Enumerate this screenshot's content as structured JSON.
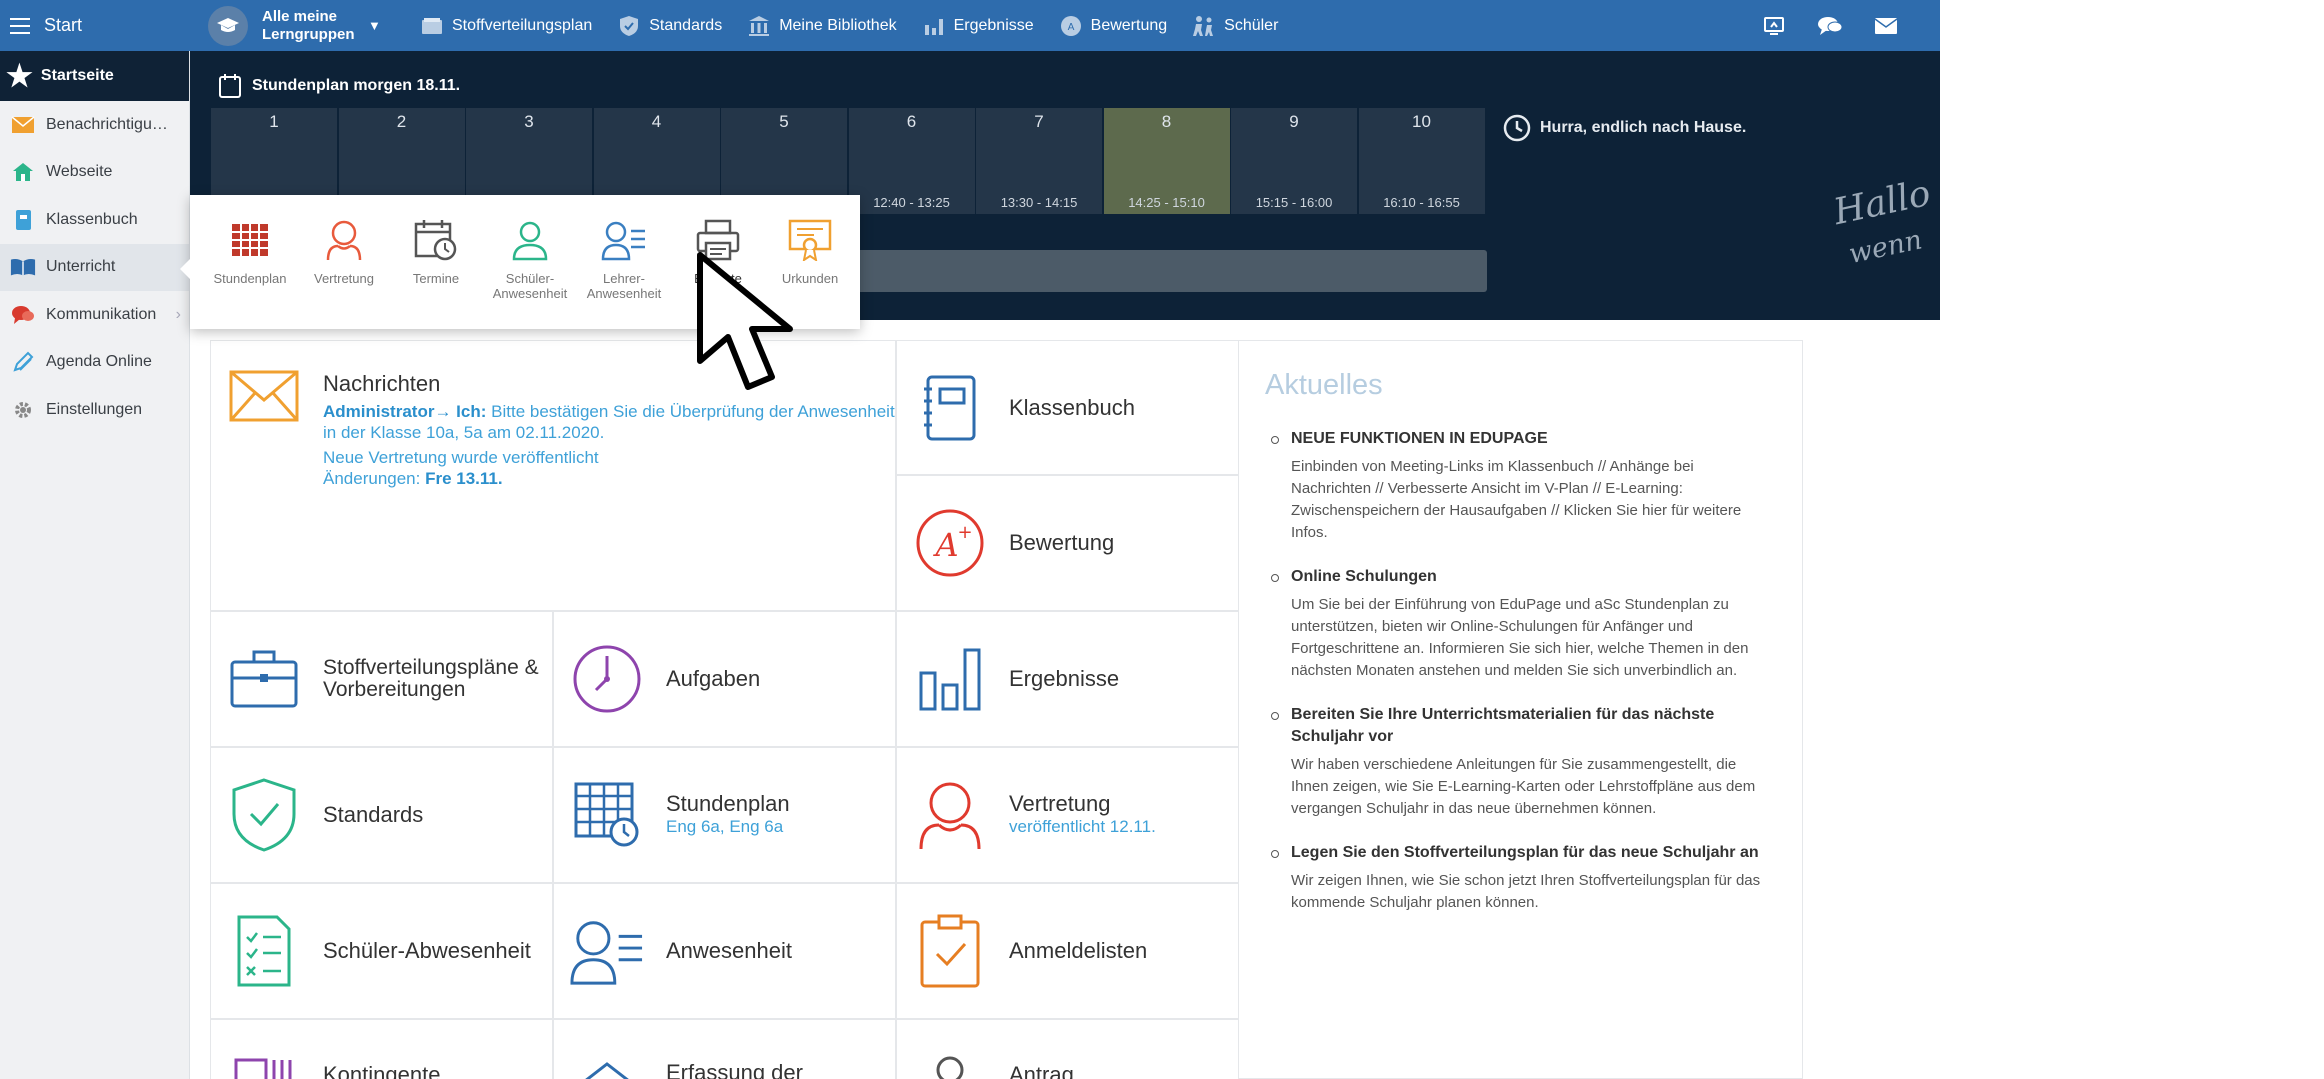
{
  "topbar": {
    "start_label": "Start",
    "groups_label": "Alle meine Lerngruppen",
    "nav": [
      {
        "label": "Stoffverteilungsplan",
        "icon": "books-icon"
      },
      {
        "label": "Standards",
        "icon": "shield-icon"
      },
      {
        "label": "Meine Bibliothek",
        "icon": "library-icon"
      },
      {
        "label": "Ergebnisse",
        "icon": "bar-chart-icon"
      },
      {
        "label": "Bewertung",
        "icon": "grade-icon"
      },
      {
        "label": "Schüler",
        "icon": "students-icon"
      }
    ]
  },
  "sidebar": {
    "home_label": "Startseite",
    "items": [
      {
        "label": "Benachrichtigu…",
        "icon": "envelope-icon",
        "color": "#f0a030"
      },
      {
        "label": "Webseite",
        "icon": "house-icon",
        "color": "#2bb58a"
      },
      {
        "label": "Klassenbuch",
        "icon": "notebook-icon",
        "color": "#3ea1d8"
      },
      {
        "label": "Unterricht",
        "icon": "open-book-icon",
        "color": "#2e6cad"
      },
      {
        "label": "Kommunikation",
        "icon": "chat-icon",
        "color": "#d83a2e"
      },
      {
        "label": "Agenda Online",
        "icon": "pen-icon",
        "color": "#3ea1d8"
      },
      {
        "label": "Einstellungen",
        "icon": "gear-icon",
        "color": "#888888"
      }
    ]
  },
  "hero": {
    "title": "Stundenplan morgen 18.11.",
    "periods": [
      {
        "num": "1",
        "time": ""
      },
      {
        "num": "2",
        "time": ""
      },
      {
        "num": "3",
        "time": ""
      },
      {
        "num": "4",
        "time": ""
      },
      {
        "num": "5",
        "time": ""
      },
      {
        "num": "6",
        "time": "12:40 - 13:25"
      },
      {
        "num": "7",
        "time": "13:30 - 14:15"
      },
      {
        "num": "8",
        "time": "14:25 - 15:10"
      },
      {
        "num": "9",
        "time": "15:15 - 16:00"
      },
      {
        "num": "10",
        "time": "16:10 - 16:55"
      }
    ],
    "note": "Hurra, endlich nach Hause.",
    "handwriting_1": "Hallo",
    "handwriting_2": "wenn"
  },
  "popup": {
    "items": [
      {
        "label": "Stundenplan",
        "icon": "timetable-icon"
      },
      {
        "label": "Vertretung",
        "icon": "substitute-icon"
      },
      {
        "label": "Termine",
        "icon": "calendar-clock-icon"
      },
      {
        "label": "Schüler-Anwesenheit",
        "icon": "student-attendance-icon"
      },
      {
        "label": "Lehrer-Anwesenheit",
        "icon": "teacher-attendance-icon"
      },
      {
        "label": "Berichte",
        "icon": "printer-icon"
      },
      {
        "label": "Urkunden",
        "icon": "certificate-icon"
      }
    ]
  },
  "tiles": {
    "messages": {
      "title": "Nachrichten",
      "line1_bold": "Administrator→ Ich:",
      "line1_rest": " Bitte bestätigen Sie die Überprüfung der Anwesenheit in der Klasse 10a, 5a am 02.11.2020.",
      "line2": "Neue Vertretung wurde veröffentlicht",
      "line3_prefix": "Änderungen: ",
      "line3_bold": "Fre 13.11."
    },
    "klassenbuch": "Klassenbuch",
    "bewertung": "Bewertung",
    "stoffverteilung": "Stoffverteilungspläne & Vorbereitungen",
    "aufgaben": "Aufgaben",
    "ergebnisse": "Ergebnisse",
    "standards": "Standards",
    "stundenplan": "Stundenplan",
    "stundenplan_sub": "Eng 6a, Eng 6a",
    "vertretung": "Vertretung",
    "vertretung_sub": "veröffentlicht 12.11.",
    "schueler_abw": "Schüler-Abwesenheit",
    "anwesenheit": "Anwesenheit",
    "anmeldelisten": "Anmeldelisten",
    "bottom_1": "Kontingente",
    "bottom_2": "Erfassung der",
    "bottom_3": "Antrag"
  },
  "news": {
    "title": "Aktuelles",
    "items": [
      {
        "heading": "NEUE FUNKTIONEN IN EDUPAGE",
        "body": "Einbinden von Meeting-Links im Klassenbuch // Anhänge bei Nachrichten // Verbesserte Ansicht im V-Plan // E-Learning: Zwischenspeichern der Hausaufgaben // Klicken Sie hier für weitere Infos."
      },
      {
        "heading": "Online Schulungen",
        "body": "Um Sie bei der Einführung von EduPage und aSc Stundenplan zu unterstützen, bieten wir Online-Schulungen für Anfänger und Fortgeschrittene an. Informieren Sie sich hier, welche Themen in den nächsten Monaten anstehen und melden Sie sich unverbindlich an."
      },
      {
        "heading": "Bereiten Sie Ihre Unterrichtsmaterialien für das nächste Schuljahr vor",
        "body": "Wir haben verschiedene Anleitungen für Sie zusammengestellt, die Ihnen zeigen, wie Sie E-Learning-Karten oder Lehrstoffpläne aus dem vergangen Schuljahr in das neue übernehmen können."
      },
      {
        "heading": "Legen Sie den Stoffverteilungsplan für das neue Schuljahr an",
        "body": "Wir zeigen Ihnen, wie Sie schon jetzt Ihren Stoffverteilungsplan für das kommende Schuljahr planen können."
      }
    ]
  }
}
